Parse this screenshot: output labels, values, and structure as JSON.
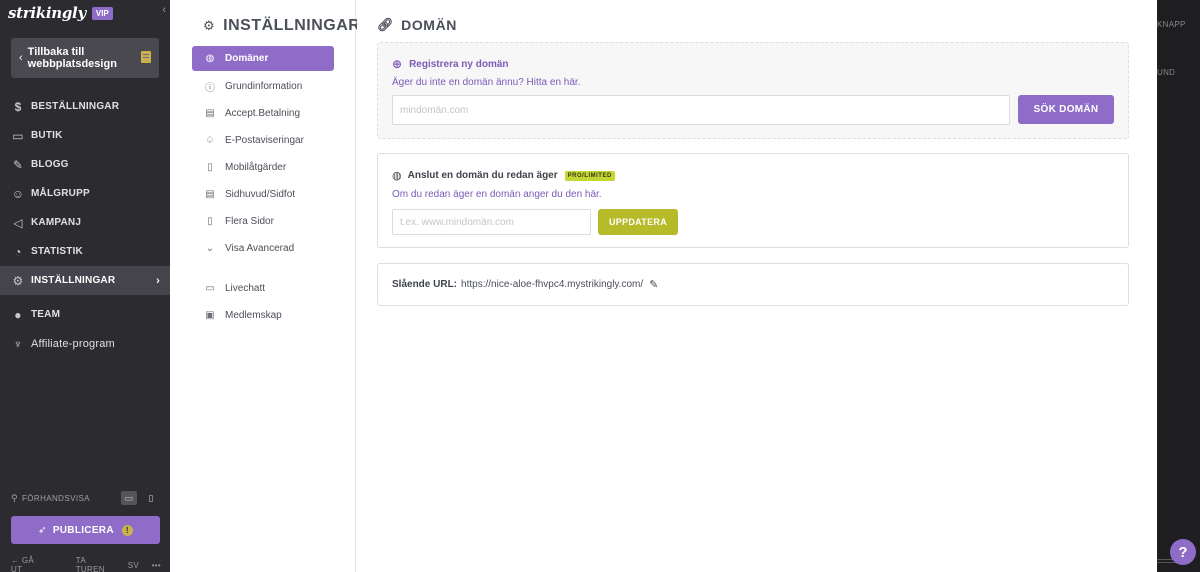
{
  "sidebar": {
    "logo": "strikingly",
    "vip_badge": "VIP",
    "collapse_icon": "chevron-left-icon",
    "back_button": "Tillbaka till webbplatsdesign",
    "nav": [
      {
        "label": "BESTÄLLNINGAR",
        "icon": "dollar-icon"
      },
      {
        "label": "BUTIK",
        "icon": "store-icon"
      },
      {
        "label": "BLOGG",
        "icon": "pen-icon"
      },
      {
        "label": "MÅLGRUPP",
        "icon": "audience-icon"
      },
      {
        "label": "KAMPANJ",
        "icon": "megaphone-icon"
      },
      {
        "label": "STATISTIK",
        "icon": "chart-icon"
      },
      {
        "label": "INSTÄLLNINGAR",
        "icon": "gear-icon",
        "active": true
      },
      {
        "label": "TEAM",
        "icon": "team-icon"
      },
      {
        "label": "Affiliate-program",
        "icon": "trophy-icon"
      }
    ],
    "preview_label": "FÖRHANDSVISA",
    "publish_label": "PUBLICERA",
    "bottom": {
      "exit": "GÅ UT",
      "tour": "TA TUREN",
      "lang": "SV"
    }
  },
  "settings": {
    "title": "INSTÄLLNINGAR",
    "menu": [
      {
        "label": "Domäner",
        "icon": "globe-icon",
        "active": true
      },
      {
        "label": "Grundinformation",
        "icon": "info-icon"
      },
      {
        "label": "Accept.Betalning",
        "icon": "card-icon"
      },
      {
        "label": "E-Postaviseringar",
        "icon": "bell-icon"
      },
      {
        "label": "Mobilåtgärder",
        "icon": "mobile-icon"
      },
      {
        "label": "Sidhuvud/Sidfot",
        "icon": "layout-icon"
      },
      {
        "label": "Flera Sidor",
        "icon": "pages-icon"
      },
      {
        "label": "Visa Avancerad",
        "icon": "chevron-down-icon"
      },
      {
        "label": "Livechatt",
        "icon": "chat-icon"
      },
      {
        "label": "Medlemskap",
        "icon": "member-icon"
      }
    ]
  },
  "main": {
    "title": "DOMÄN",
    "register": {
      "heading": "Registrera ny domän",
      "subtext": "Äger du inte en domän ännu? Hitta en här.",
      "placeholder": "mindomän.com",
      "button": "SÖK DOMÄN"
    },
    "connect": {
      "heading": "Anslut en domän du redan äger",
      "badge": "PRO/LIMITED",
      "subtext": "Om du redan äger en domän anger du den här.",
      "placeholder": "t.ex. www.mindomän.com",
      "button": "UPPDATERA"
    },
    "url": {
      "label": "Slående URL:",
      "value": "https://nice-aloe-fhvpc4.mystrikingly.com/"
    }
  },
  "right_edge": {
    "text1": "KNAPP",
    "text2": "UND"
  },
  "help_label": "?",
  "colors": {
    "accent": "#8e6cc7",
    "sidebar_bg": "#2c2b2f",
    "lime": "#b6bb2a"
  }
}
